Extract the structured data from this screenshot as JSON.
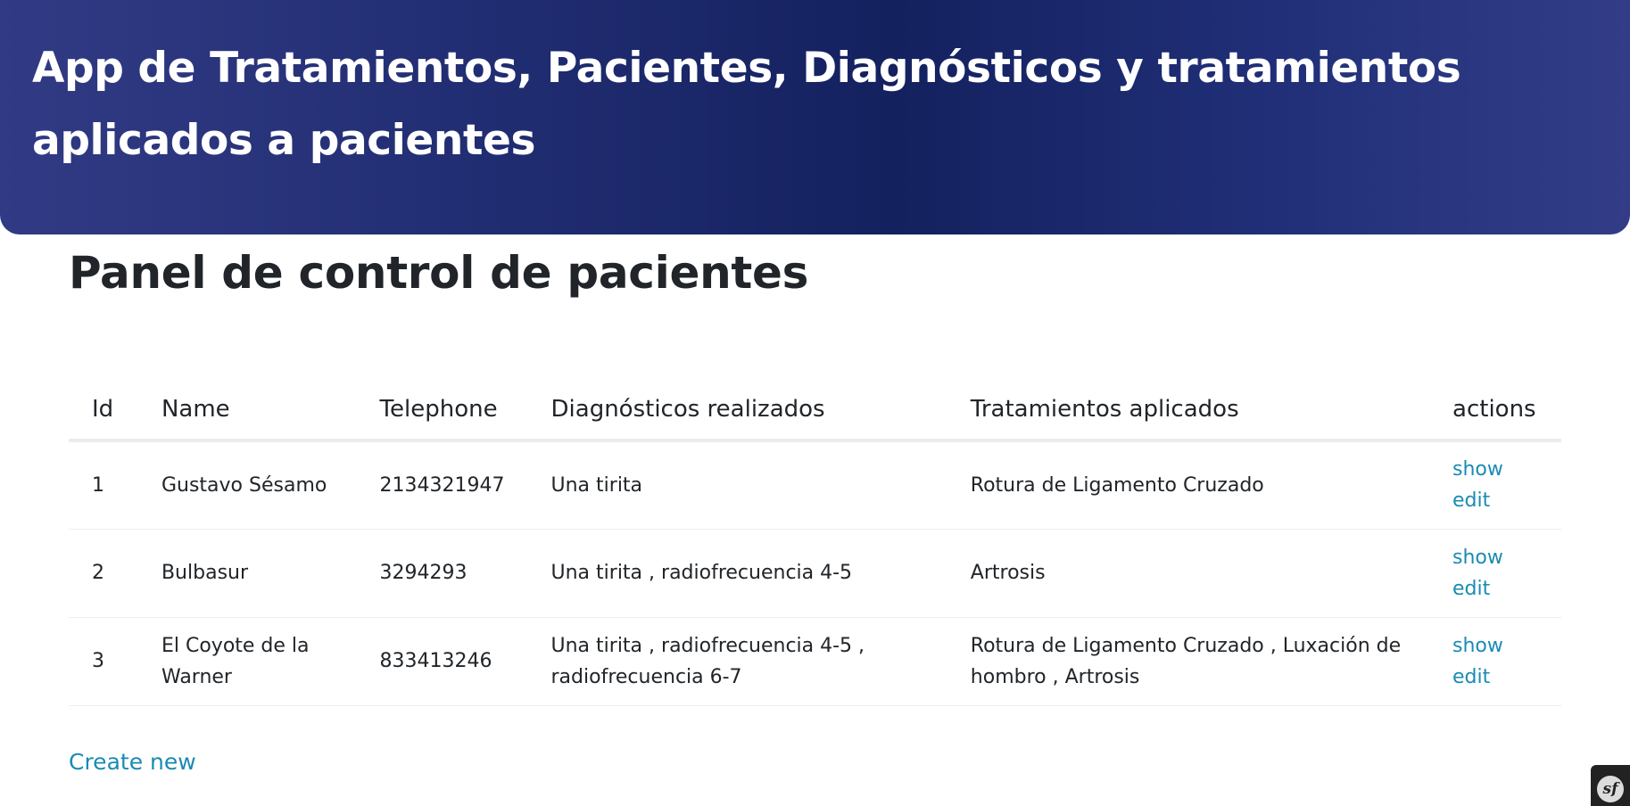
{
  "header": {
    "title": "App de Tratamientos, Pacientes, Diagnósticos y tratamientos aplicados a pacientes"
  },
  "page": {
    "title": "Panel de control de pacientes"
  },
  "table": {
    "columns": [
      "Id",
      "Name",
      "Telephone",
      "Diagnósticos realizados",
      "Tratamientos aplicados",
      "actions"
    ],
    "rows": [
      {
        "id": "1",
        "name": "Gustavo Sésamo",
        "telephone": "2134321947",
        "diagnosticos": "Una tirita",
        "tratamientos": "Rotura de Ligamento Cruzado",
        "show": "show",
        "edit": "edit"
      },
      {
        "id": "2",
        "name": "Bulbasur",
        "telephone": "3294293",
        "diagnosticos": "Una tirita , radiofrecuencia 4-5",
        "tratamientos": "Artrosis",
        "show": "show",
        "edit": "edit"
      },
      {
        "id": "3",
        "name": "El Coyote de la Warner",
        "telephone": "833413246",
        "diagnosticos": "Una tirita , radiofrecuencia 4-5 , radiofrecuencia 6-7",
        "tratamientos": "Rotura de Ligamento Cruzado , Luxación de hombro , Artrosis",
        "show": "show",
        "edit": "edit"
      }
    ]
  },
  "footer": {
    "create_label": "Create new"
  },
  "toolbar": {
    "logo_text": "sf",
    "icon": "symfony-logo-icon"
  },
  "colors": {
    "header_bg": "#1b2766",
    "link": "#1a8bb3",
    "text": "#212529"
  }
}
